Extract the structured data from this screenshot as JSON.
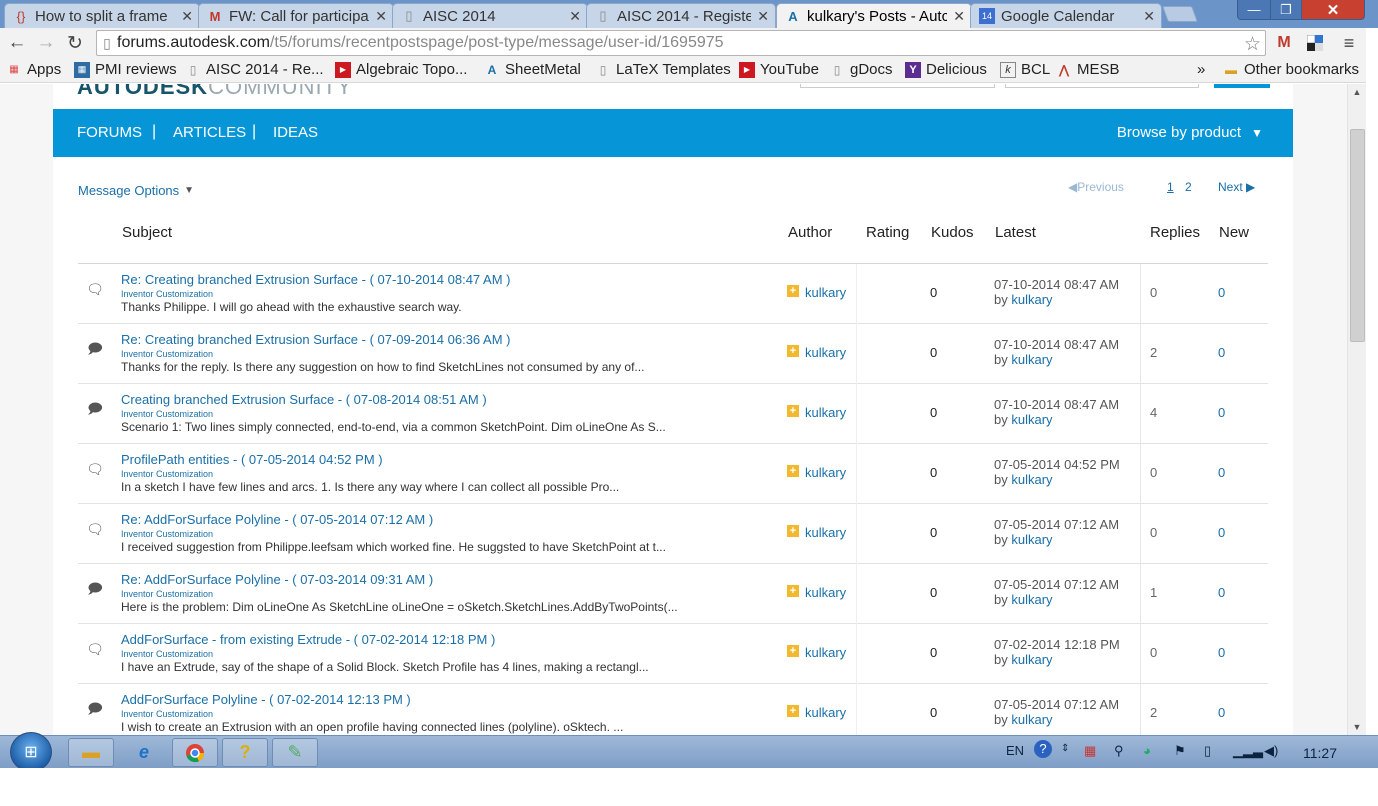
{
  "browser": {
    "tabs": [
      {
        "label": "How to split a frame",
        "icon": "autodesk-braces-icon"
      },
      {
        "label": "FW: Call for participa",
        "icon": "gmail-icon"
      },
      {
        "label": "AISC 2014",
        "icon": "document-icon"
      },
      {
        "label": "AISC 2014 - Register",
        "icon": "document-icon"
      },
      {
        "label": "kulkary's Posts - Autc",
        "icon": "autodesk-icon"
      },
      {
        "label": "Google Calendar",
        "icon": "calendar-icon"
      }
    ],
    "active_tab": 4,
    "url_host": "forums.autodesk.com",
    "url_path": "/t5/forums/recentpostspage/post-type/message/user-id/1695975",
    "bookmarks": [
      {
        "label": "Apps"
      },
      {
        "label": "PMI reviews"
      },
      {
        "label": "AISC 2014 - Re..."
      },
      {
        "label": "Algebraic Topo..."
      },
      {
        "label": "SheetMetal"
      },
      {
        "label": "LaTeX Templates"
      },
      {
        "label": "YouTube"
      },
      {
        "label": "gDocs"
      },
      {
        "label": "Delicious"
      },
      {
        "label": "BCL"
      },
      {
        "label": "MESB"
      }
    ],
    "bookmarks_overflow": "»",
    "other_bookmarks": "Other bookmarks"
  },
  "site": {
    "nav": [
      "FORUMS",
      "ARTICLES",
      "IDEAS"
    ],
    "nav_sep": "|",
    "browse": "Browse by product",
    "message_options": "Message Options",
    "pager": {
      "previous": "Previous",
      "page1": "1",
      "page2": "2",
      "next": "Next"
    }
  },
  "table": {
    "headers": {
      "subject": "Subject",
      "author": "Author",
      "rating": "Rating",
      "kudos": "Kudos",
      "latest": "Latest",
      "replies": "Replies",
      "new": "New"
    },
    "rows": [
      {
        "icon": "single-bubble-icon",
        "subject": "Re: Creating branched Extrusion Surface",
        "date": " - ( 07-10-2014 08:47 AM )",
        "board": "Inventor Customization",
        "preview": "Thanks Philippe. I will go ahead with the exhaustive search way.",
        "author": "kulkary",
        "kudos": "0",
        "latest_date": "07-10-2014 08:47 AM",
        "latest_by": "by ",
        "latest_user": "kulkary",
        "replies": "0",
        "new": "0"
      },
      {
        "icon": "thread-bubble-icon",
        "subject": "Re: Creating branched Extrusion Surface",
        "date": " - ( 07-09-2014 06:36 AM )",
        "board": "Inventor Customization",
        "preview": "Thanks for the reply.   Is there any suggestion on how to find SketchLines not consumed by any of...",
        "author": "kulkary",
        "kudos": "0",
        "latest_date": "07-10-2014 08:47 AM",
        "latest_by": "by ",
        "latest_user": "kulkary",
        "replies": "2",
        "new": "0"
      },
      {
        "icon": "thread-bubble-icon",
        "subject": "Creating branched Extrusion Surface",
        "date": " - ( 07-08-2014 08:51 AM )",
        "board": "Inventor Customization",
        "preview": "Scenario 1: Two lines simply connected, end-to-end, via a common SketchPoint.   Dim oLineOne As S...",
        "author": "kulkary",
        "kudos": "0",
        "latest_date": "07-10-2014 08:47 AM",
        "latest_by": "by ",
        "latest_user": "kulkary",
        "replies": "4",
        "new": "0"
      },
      {
        "icon": "single-bubble-icon",
        "subject": "ProfilePath entities",
        "date": " - ( 07-05-2014 04:52 PM )",
        "board": "Inventor Customization",
        "preview": "In a sketch I have few lines and arcs.   1. Is there any way where I can collect all possible Pro...",
        "author": "kulkary",
        "kudos": "0",
        "latest_date": "07-05-2014 04:52 PM",
        "latest_by": "by ",
        "latest_user": "kulkary",
        "replies": "0",
        "new": "0"
      },
      {
        "icon": "single-bubble-icon",
        "subject": "Re: AddForSurface Polyline",
        "date": " - ( 07-05-2014 07:12 AM )",
        "board": "Inventor Customization",
        "preview": "I received suggestion from Philippe.leefsam which worked fine. He suggsted to have SketchPoint at t...",
        "author": "kulkary",
        "kudos": "0",
        "latest_date": "07-05-2014 07:12 AM",
        "latest_by": "by ",
        "latest_user": "kulkary",
        "replies": "0",
        "new": "0"
      },
      {
        "icon": "thread-bubble-icon",
        "subject": "Re: AddForSurface Polyline",
        "date": " - ( 07-03-2014 09:31 AM )",
        "board": "Inventor Customization",
        "preview": "Here is the problem:   Dim oLineOne As SketchLine oLineOne = oSketch.SketchLines.AddByTwoPoints(...",
        "author": "kulkary",
        "kudos": "0",
        "latest_date": "07-05-2014 07:12 AM",
        "latest_by": "by ",
        "latest_user": "kulkary",
        "replies": "1",
        "new": "0"
      },
      {
        "icon": "single-bubble-icon",
        "subject": "AddForSurface - from existing Extrude",
        "date": " - ( 07-02-2014 12:18 PM )",
        "board": "Inventor Customization",
        "preview": "I have an Extrude, say of the shape of a Solid Block. Sketch Profile has 4 lines, making a rectangl...",
        "author": "kulkary",
        "kudos": "0",
        "latest_date": "07-02-2014 12:18 PM",
        "latest_by": "by ",
        "latest_user": "kulkary",
        "replies": "0",
        "new": "0"
      },
      {
        "icon": "thread-bubble-icon",
        "subject": "AddForSurface Polyline",
        "date": " - ( 07-02-2014 12:13 PM )",
        "board": "Inventor Customization",
        "preview": "I wish to create an Extrusion with an open profile having connected lines (polyline).   oSktech. ...",
        "author": "kulkary",
        "kudos": "0",
        "latest_date": "07-05-2014 07:12 AM",
        "latest_by": "by ",
        "latest_user": "kulkary",
        "replies": "2",
        "new": "0"
      }
    ]
  },
  "taskbar": {
    "language": "EN",
    "clock": "11:27"
  },
  "colors": {
    "accent": "#0696d7",
    "link": "#1a6fa8",
    "rank": "#f3b92e"
  }
}
